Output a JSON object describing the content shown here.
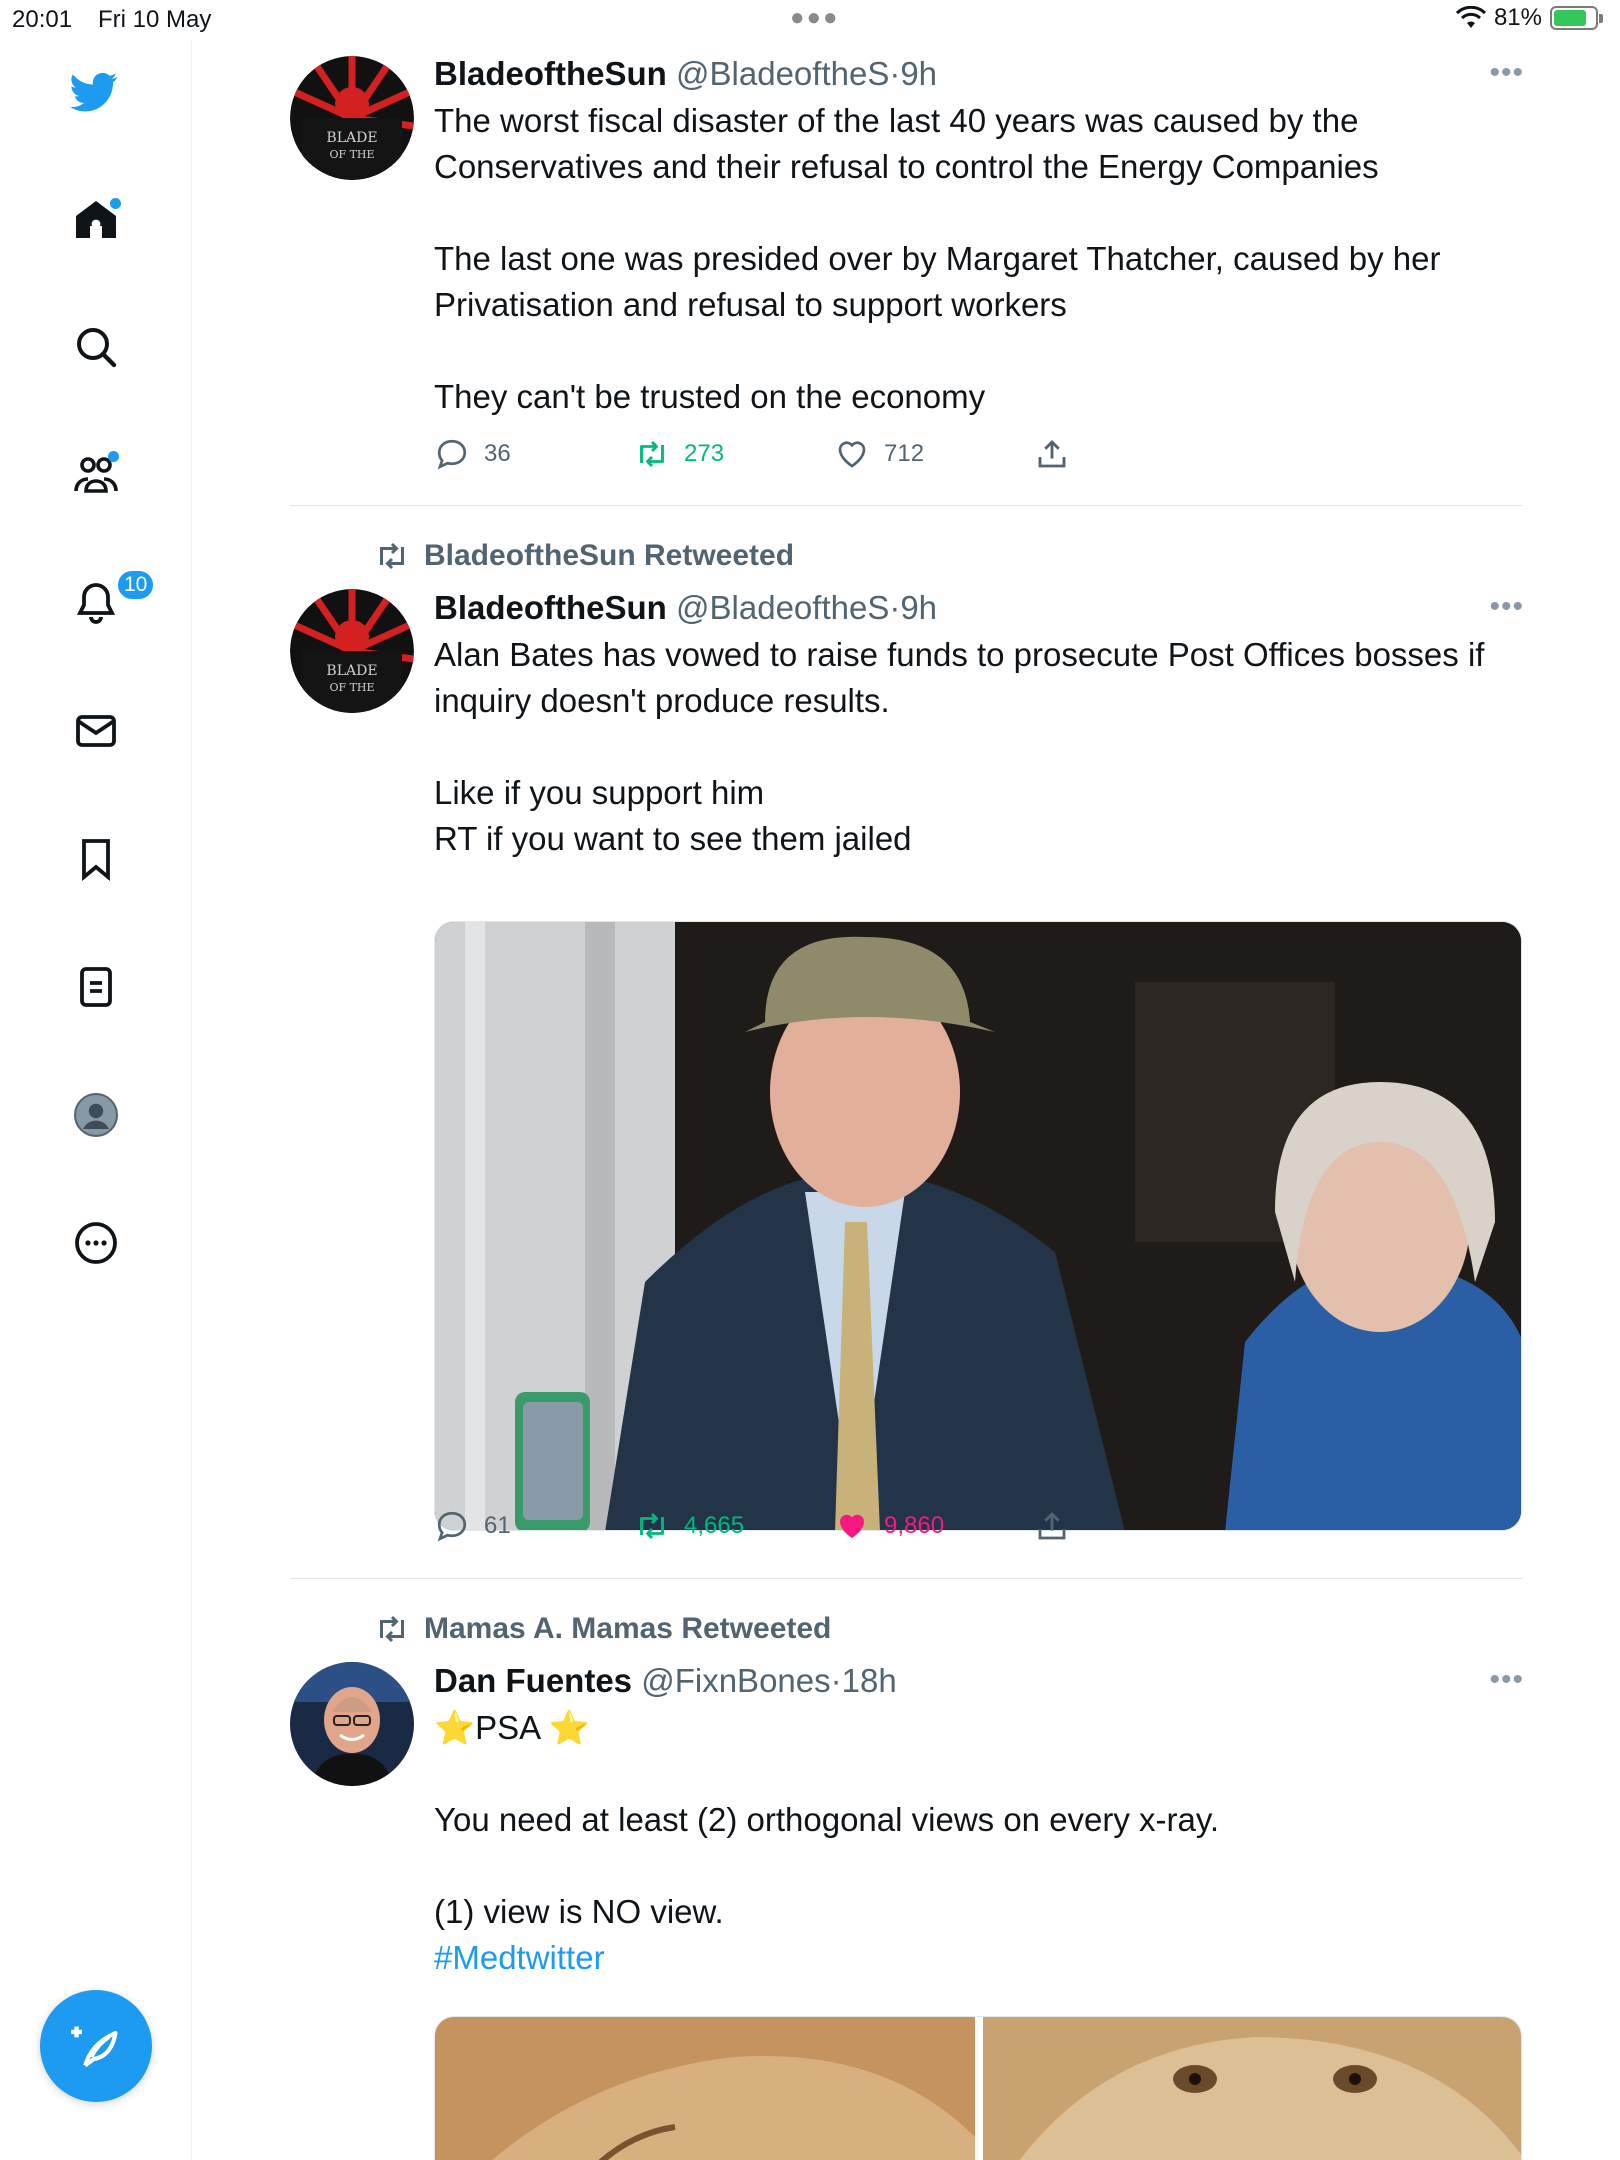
{
  "status_bar": {
    "time": "20:01",
    "date": "Fri 10 May",
    "battery": "81%",
    "battery_level": 0.81
  },
  "sidebar": {
    "notifications_count": "10",
    "items": [
      "home",
      "explore",
      "communities",
      "notifications",
      "messages",
      "bookmarks",
      "lists",
      "profile",
      "more"
    ]
  },
  "colors": {
    "accent": "#1d9bf0",
    "retweet": "#00ba7c",
    "like": "#f91880",
    "muted": "#536471"
  },
  "tweets": [
    {
      "retweeted_by": "",
      "display_name": "BladeoftheSun",
      "handle": "@BladeoftheS",
      "separator": "·",
      "time": "9h",
      "text": "The worst fiscal disaster of the last 40 years was caused by the Conservatives and their refusal to control the Energy Companies\n\nThe last one was presided over by Margaret Thatcher, caused by her Privatisation and refusal to support workers\n\nThey can't be trusted on the economy",
      "replies": "36",
      "retweets": "273",
      "likes": "712"
    },
    {
      "retweeted_by": "BladeoftheSun Retweeted",
      "display_name": "BladeoftheSun",
      "handle": "@BladeoftheS",
      "separator": "·",
      "time": "9h",
      "text": "Alan Bates has vowed to raise funds to prosecute Post Offices bosses if inquiry doesn't produce results.\n\nLike if you support him\nRT if you want to see them jailed",
      "replies": "61",
      "retweets": "4,665",
      "likes": "9,860"
    },
    {
      "retweeted_by": "Mamas A. Mamas Retweeted",
      "display_name": "Dan Fuentes",
      "handle": "@FixnBones",
      "separator": "·",
      "time": "18h",
      "text_star_left": "⭐",
      "text_psa": "PSA",
      "text_star_right": "⭐",
      "text": "You need at least (2) orthogonal views on every x-ray.\n\n(1) view is NO view.",
      "hashtag": "#Medtwitter"
    }
  ]
}
